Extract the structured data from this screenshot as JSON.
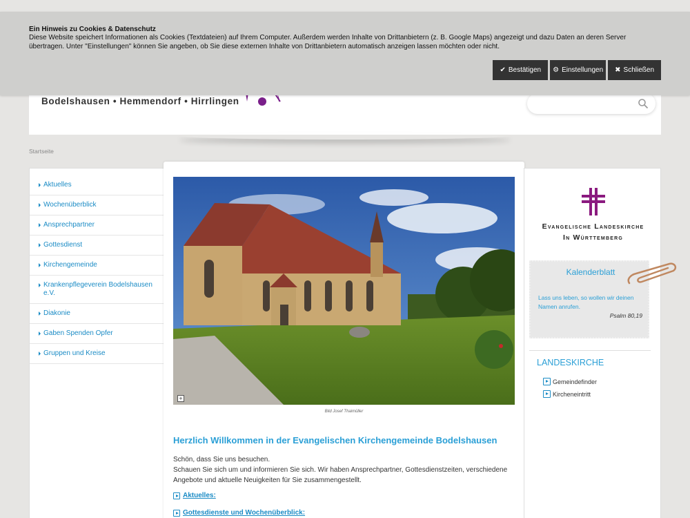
{
  "cookie_banner": {
    "title": "Ein Hinweis zu Cookies & Datenschutz",
    "text": "Diese Website speichert Informationen als Cookies (Textdateien) auf Ihrem Computer. Außerdem werden Inhalte von Drittanbietern (z. B. Google Maps) angezeigt und dazu Daten an deren Server übertragen. Unter \"Einstellungen\" können Sie angeben, ob Sie diese externen Inhalte von Drittanbietern automatisch anzeigen lassen möchten oder nicht.",
    "confirm_label": "Bestätigen",
    "settings_label": "Einstellungen",
    "close_label": "Schließen"
  },
  "header": {
    "brand_text": "Bodelshausen • Hemmendorf • Hirrlingen",
    "search_placeholder": ""
  },
  "breadcrumb": "Startseite",
  "nav": {
    "items": [
      "Aktuelles",
      "Wochenüberblick",
      "Ansprechpartner",
      "Gottesdienst",
      "Kirchengemeinde",
      "Krankenpflegeverein Bodelshausen e.V.",
      "Diakonie",
      "Gaben Spenden Opfer",
      "Gruppen und Kreise"
    ]
  },
  "main": {
    "photo_caption": "Bild Josef Thaimüller",
    "welcome_heading": "Herzlich Willkommen in der Evangelischen Kirchengemeinde Bodelshausen",
    "intro_line1": "Schön, dass Sie uns besuchen.",
    "intro_line2": "Schauen Sie sich um und informieren Sie sich. Wir haben Ansprechpartner, Gottesdienstzeiten, verschiedene Angebote und aktuelle Neuigkeiten für Sie zusammengestellt.",
    "link_aktuelles": "Aktuelles:",
    "link_gottesdienste": "Gottesdienste und Wochenüberblick:"
  },
  "sidebar": {
    "elk_line1": "Evangelische Landeskirche",
    "elk_line2": "In Württemberg",
    "calendar_title": "Kalenderblatt",
    "calendar_text": "Lass uns leben, so wollen wir deinen Namen anrufen.",
    "calendar_ref": "Psalm 80,19",
    "section_heading": "LANDESKIRCHE",
    "link_gemeindefinder": "Gemeindefinder",
    "link_kircheneintritt": "Kircheneintritt"
  },
  "colors": {
    "accent": "#2a9fd6",
    "link": "#1a8bc5",
    "brand_purple": "#8b1a7f",
    "button_dark": "#333333"
  }
}
